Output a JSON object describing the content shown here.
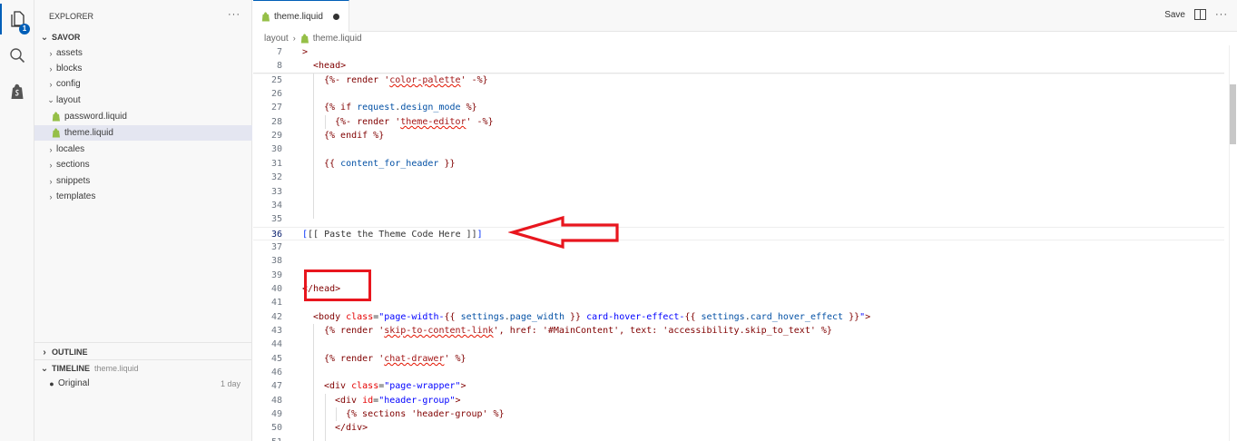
{
  "activity_bar": {
    "explorer_badge": "1"
  },
  "sidebar": {
    "header": "EXPLORER",
    "more": "···",
    "root": "SAVOR",
    "items": [
      {
        "label": "assets",
        "type": "folder",
        "expanded": false
      },
      {
        "label": "blocks",
        "type": "folder",
        "expanded": false
      },
      {
        "label": "config",
        "type": "folder",
        "expanded": false
      },
      {
        "label": "layout",
        "type": "folder",
        "expanded": true
      },
      {
        "label": "password.liquid",
        "type": "file"
      },
      {
        "label": "theme.liquid",
        "type": "file",
        "selected": true
      },
      {
        "label": "locales",
        "type": "folder",
        "expanded": false
      },
      {
        "label": "sections",
        "type": "folder",
        "expanded": false
      },
      {
        "label": "snippets",
        "type": "folder",
        "expanded": false
      },
      {
        "label": "templates",
        "type": "folder",
        "expanded": false
      }
    ],
    "outline": "OUTLINE",
    "timeline": "TIMELINE",
    "timeline_file": "theme.liquid",
    "timeline_entry": "Original",
    "timeline_time": "1 day"
  },
  "editor": {
    "tab_label": "theme.liquid",
    "save_label": "Save",
    "more": "···",
    "breadcrumb": [
      "layout",
      "theme.liquid"
    ],
    "current_line": "36"
  },
  "colors": {
    "accent": "#005fb8",
    "annotation": "#e8161e",
    "selected_item": "#e4e6f1"
  },
  "code_lines": [
    {
      "n": "7",
      "indent": 0,
      "parts": [
        {
          "t": ">",
          "c": "t-tag"
        }
      ]
    },
    {
      "n": "8",
      "indent": 1,
      "parts": [
        {
          "t": "<head>",
          "c": "t-tag"
        }
      ]
    },
    {
      "n": "25",
      "indent": 2,
      "parts": [
        {
          "t": "{%- render '",
          "c": "t-tag"
        },
        {
          "t": "color-palette",
          "c": "t-err"
        },
        {
          "t": "' -%}",
          "c": "t-tag"
        }
      ]
    },
    {
      "n": "26",
      "indent": 0,
      "parts": []
    },
    {
      "n": "27",
      "indent": 2,
      "parts": [
        {
          "t": "{% if ",
          "c": "t-tag"
        },
        {
          "t": "request",
          "c": "t-liq"
        },
        {
          "t": ".",
          "c": "t-plain"
        },
        {
          "t": "design_mode",
          "c": "t-liq"
        },
        {
          "t": " %}",
          "c": "t-tag"
        }
      ]
    },
    {
      "n": "28",
      "indent": 3,
      "parts": [
        {
          "t": "{%- render '",
          "c": "t-tag"
        },
        {
          "t": "theme-editor",
          "c": "t-err"
        },
        {
          "t": "' -%}",
          "c": "t-tag"
        }
      ]
    },
    {
      "n": "29",
      "indent": 2,
      "parts": [
        {
          "t": "{% endif %}",
          "c": "t-tag"
        }
      ]
    },
    {
      "n": "30",
      "indent": 0,
      "parts": []
    },
    {
      "n": "31",
      "indent": 2,
      "parts": [
        {
          "t": "{{ ",
          "c": "t-tag"
        },
        {
          "t": "content_for_header",
          "c": "t-liq"
        },
        {
          "t": " }}",
          "c": "t-tag"
        }
      ]
    },
    {
      "n": "32",
      "indent": 0,
      "parts": []
    },
    {
      "n": "33",
      "indent": 0,
      "parts": []
    },
    {
      "n": "34",
      "indent": 0,
      "parts": []
    },
    {
      "n": "35",
      "indent": 0,
      "parts": []
    },
    {
      "n": "36",
      "indent": 0,
      "current": true,
      "parts": [
        {
          "t": "[",
          "c": "t-bracket"
        },
        {
          "t": "[[ Paste the Theme Code Here ]]",
          "c": "t-plain"
        },
        {
          "t": "]",
          "c": "t-bracket"
        }
      ]
    },
    {
      "n": "37",
      "indent": 0,
      "parts": []
    },
    {
      "n": "38",
      "indent": 0,
      "parts": []
    },
    {
      "n": "39",
      "indent": 0,
      "parts": []
    },
    {
      "n": "40",
      "indent": 0,
      "parts": [
        {
          "t": "</head>",
          "c": "t-tag"
        }
      ]
    },
    {
      "n": "41",
      "indent": 0,
      "parts": []
    },
    {
      "n": "42",
      "indent": 1,
      "parts": [
        {
          "t": "<body ",
          "c": "t-tag"
        },
        {
          "t": "class",
          "c": "t-attr"
        },
        {
          "t": "=",
          "c": "t-plain"
        },
        {
          "t": "\"page-width-",
          "c": "t-str"
        },
        {
          "t": "{{ ",
          "c": "t-tag"
        },
        {
          "t": "settings",
          "c": "t-liq"
        },
        {
          "t": ".",
          "c": "t-plain"
        },
        {
          "t": "page_width",
          "c": "t-liq"
        },
        {
          "t": " }}",
          "c": "t-tag"
        },
        {
          "t": " card-hover-effect-",
          "c": "t-str"
        },
        {
          "t": "{{ ",
          "c": "t-tag"
        },
        {
          "t": "settings",
          "c": "t-liq"
        },
        {
          "t": ".",
          "c": "t-plain"
        },
        {
          "t": "card_hover_effect",
          "c": "t-liq"
        },
        {
          "t": " }}",
          "c": "t-tag"
        },
        {
          "t": "\"",
          "c": "t-str"
        },
        {
          "t": ">",
          "c": "t-tag"
        }
      ]
    },
    {
      "n": "43",
      "indent": 2,
      "parts": [
        {
          "t": "{% render '",
          "c": "t-tag"
        },
        {
          "t": "skip-to-content-link",
          "c": "t-err"
        },
        {
          "t": "', href: '#MainContent', text: 'accessibility.skip_to_text' %}",
          "c": "t-tag"
        }
      ]
    },
    {
      "n": "44",
      "indent": 0,
      "parts": []
    },
    {
      "n": "45",
      "indent": 2,
      "parts": [
        {
          "t": "{% render '",
          "c": "t-tag"
        },
        {
          "t": "chat-drawer",
          "c": "t-err"
        },
        {
          "t": "' %}",
          "c": "t-tag"
        }
      ]
    },
    {
      "n": "46",
      "indent": 0,
      "parts": []
    },
    {
      "n": "47",
      "indent": 2,
      "parts": [
        {
          "t": "<div ",
          "c": "t-tag"
        },
        {
          "t": "class",
          "c": "t-attr"
        },
        {
          "t": "=",
          "c": "t-plain"
        },
        {
          "t": "\"page-wrapper\"",
          "c": "t-str"
        },
        {
          "t": ">",
          "c": "t-tag"
        }
      ]
    },
    {
      "n": "48",
      "indent": 3,
      "parts": [
        {
          "t": "<div ",
          "c": "t-tag"
        },
        {
          "t": "id",
          "c": "t-attr"
        },
        {
          "t": "=",
          "c": "t-plain"
        },
        {
          "t": "\"header-group\"",
          "c": "t-str"
        },
        {
          "t": ">",
          "c": "t-tag"
        }
      ]
    },
    {
      "n": "49",
      "indent": 4,
      "parts": [
        {
          "t": "{% sections 'header-group' %}",
          "c": "t-tag"
        }
      ]
    },
    {
      "n": "50",
      "indent": 3,
      "parts": [
        {
          "t": "</div>",
          "c": "t-tag"
        }
      ]
    },
    {
      "n": "51",
      "indent": 0,
      "parts": []
    }
  ]
}
